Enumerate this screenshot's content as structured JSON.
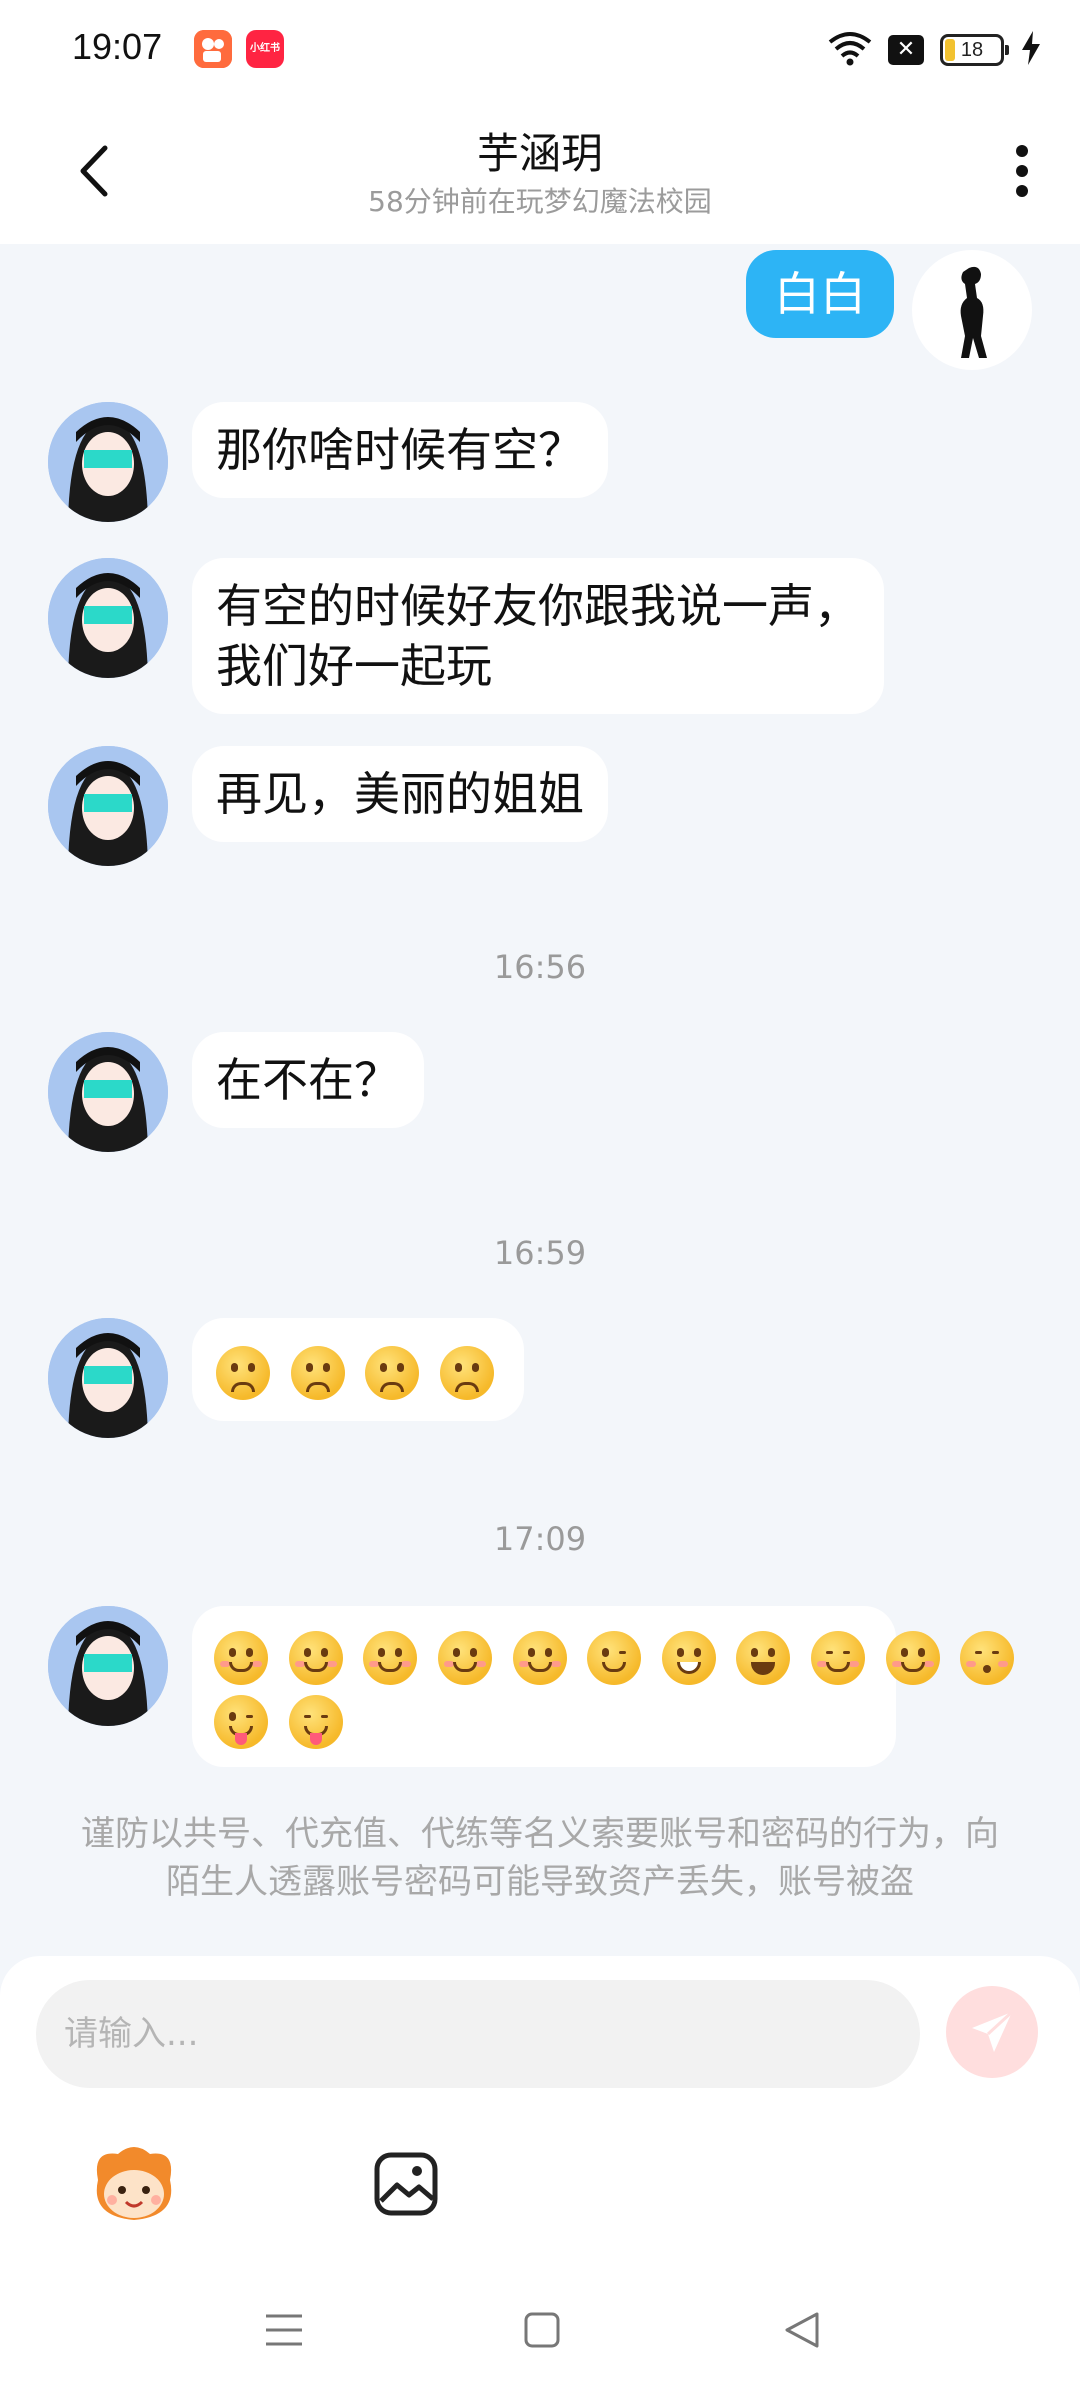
{
  "status_bar": {
    "time": "19:07",
    "app_badges": [
      "kuaishou-icon",
      "xiaohongshu-icon"
    ],
    "xhs_label": "小红书",
    "battery_level": "18",
    "icons": [
      "wifi-icon",
      "sim-off-icon",
      "battery-icon",
      "charging-icon"
    ]
  },
  "header": {
    "title": "芋涵玥",
    "subtitle": "58分钟前在玩梦幻魔法校园",
    "back_icon": "back-arrow-icon",
    "more_icon": "more-vertical-icon"
  },
  "messages": [
    {
      "sender": "me",
      "text": "白白"
    },
    {
      "sender": "friend",
      "text": "那你啥时候有空？"
    },
    {
      "sender": "friend",
      "lines": [
        "有空的时候好友你跟我说一声，",
        "我们好一起玩"
      ]
    },
    {
      "sender": "friend",
      "text": "再见，美丽的姐姐"
    },
    {
      "type": "time",
      "text": "16:56"
    },
    {
      "sender": "friend",
      "text": "在不在？"
    },
    {
      "type": "time",
      "text": "16:59"
    },
    {
      "sender": "friend",
      "emoji": [
        "slightly-frowning",
        "slightly-frowning",
        "slightly-frowning",
        "slightly-frowning"
      ]
    },
    {
      "type": "time",
      "text": "17:09"
    },
    {
      "sender": "friend",
      "emoji": [
        "smiling-blush",
        "smiling-blush",
        "smiling-blush",
        "smiling-blush",
        "smiling-blush",
        "winking",
        "grinning",
        "smiley",
        "smiling-eyes",
        "smiling-blush",
        "kissing-closed-eyes",
        "winking-tongue",
        "squinting-tongue"
      ]
    }
  ],
  "notice": "谨防以共号、代充值、代练等名义索要账号和密码的行为，向陌生人透露账号密码可能导致资产丢失，账号被盗",
  "input": {
    "placeholder": "请输入..."
  },
  "tools": [
    "mascot-face-icon",
    "image-icon"
  ],
  "nav": [
    "menu-icon",
    "home-square-icon",
    "back-triangle-icon"
  ],
  "colors": {
    "my_bubble": "#2db4f5",
    "background": "#f3f6fa",
    "send_button": "#ffdede"
  }
}
